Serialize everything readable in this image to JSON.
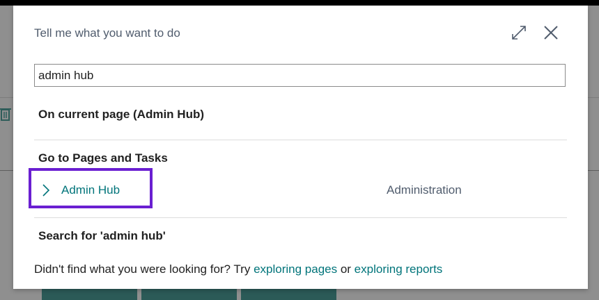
{
  "dialog": {
    "title": "Tell me what you want to do",
    "search_value": "admin hub"
  },
  "sections": {
    "current_page": "On current page (Admin Hub)",
    "pages_and_tasks": "Go to Pages and Tasks",
    "search_for": "Search for 'admin hub'"
  },
  "results": [
    {
      "label": "Admin Hub",
      "category": "Administration"
    }
  ],
  "footer": {
    "prefix": "Didn't find what you were looking for? Try ",
    "link_pages": "exploring pages",
    "middle": " or ",
    "link_reports": "exploring reports"
  },
  "colors": {
    "link": "#00747a",
    "highlight_border": "#6a1fd1"
  }
}
